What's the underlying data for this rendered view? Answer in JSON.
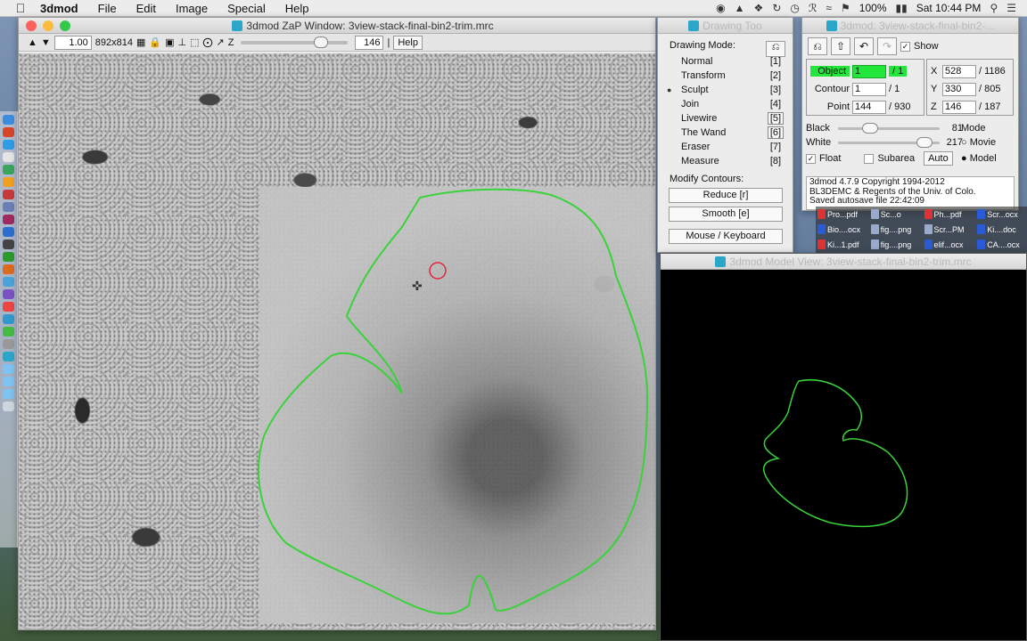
{
  "menubar": {
    "app_name": "3dmod",
    "items": [
      "File",
      "Edit",
      "Image",
      "Special",
      "Help"
    ],
    "battery": "100%",
    "clock": "Sat 10:44 PM"
  },
  "zap": {
    "title": "3dmod ZaP Window: 3view-stack-final-bin2-trim.mrc",
    "zoom": "1.00",
    "size": "892x814",
    "z_label": "Z",
    "z_value": "146",
    "z_slider_fraction": 0.78,
    "help_label": "Help"
  },
  "drawing": {
    "title": "Drawing Too",
    "mode_header": "Drawing Mode:",
    "modes": [
      {
        "label": "Normal",
        "key": "[1]"
      },
      {
        "label": "Transform",
        "key": "[2]"
      },
      {
        "label": "Sculpt",
        "key": "[3]"
      },
      {
        "label": "Join",
        "key": "[4]"
      },
      {
        "label": "Livewire",
        "key": "[5]"
      },
      {
        "label": "The Wand",
        "key": "[6]"
      },
      {
        "label": "Eraser",
        "key": "[7]"
      },
      {
        "label": "Measure",
        "key": "[8]"
      }
    ],
    "selected_mode": "Sculpt",
    "modify_header": "Modify Contours:",
    "reduce_label": "Reduce [r]",
    "smooth_label": "Smooth [e]",
    "mouse_keyboard_label": "Mouse / Keyboard"
  },
  "info": {
    "title": "3dmod: 3view-stack-final-bin2-...",
    "show_label": "Show",
    "object_label": "Object",
    "object_value": "1",
    "object_total": "/ 1",
    "contour_label": "Contour",
    "contour_value": "1",
    "contour_total": "/ 1",
    "point_label": "Point",
    "point_value": "144",
    "point_total": "/ 930",
    "x_label": "X",
    "x_value": "528",
    "x_total": "/ 1186",
    "y_label": "Y",
    "y_value": "330",
    "y_total": "/ 805",
    "z_label": "Z",
    "z_value": "146",
    "z_total": "/ 187",
    "black_label": "Black",
    "black_value": "81",
    "white_label": "White",
    "white_value": "217",
    "mode_header": "Mode",
    "mode_movie": "Movie",
    "mode_model": "Model",
    "float_label": "Float",
    "subarea_label": "Subarea",
    "auto_label": "Auto",
    "log_lines": [
      "3dmod 4.7.9 Copyright 1994-2012",
      "BL3DEMC & Regents of the Univ. of Colo.",
      "Saved autosave file 22:42:09"
    ]
  },
  "files": {
    "row1": [
      "Pro...pdf",
      "Sc...o",
      "Ph...pdf",
      "Scr...ocx"
    ],
    "row2": [
      "Bio....ocx",
      "fig....png",
      "Scr...PM",
      "Ki....doc"
    ],
    "row3": [
      "Ki...1.pdf",
      "fig....png",
      "elif...ocx",
      "CA....ocx"
    ]
  },
  "model": {
    "title": "3dmod Model View: 3view-stack-final-bin2-trim.mrc"
  },
  "colors": {
    "contour": "#3ad23a",
    "object_green": "#22e63a",
    "cursor_red": "#e3243b"
  }
}
